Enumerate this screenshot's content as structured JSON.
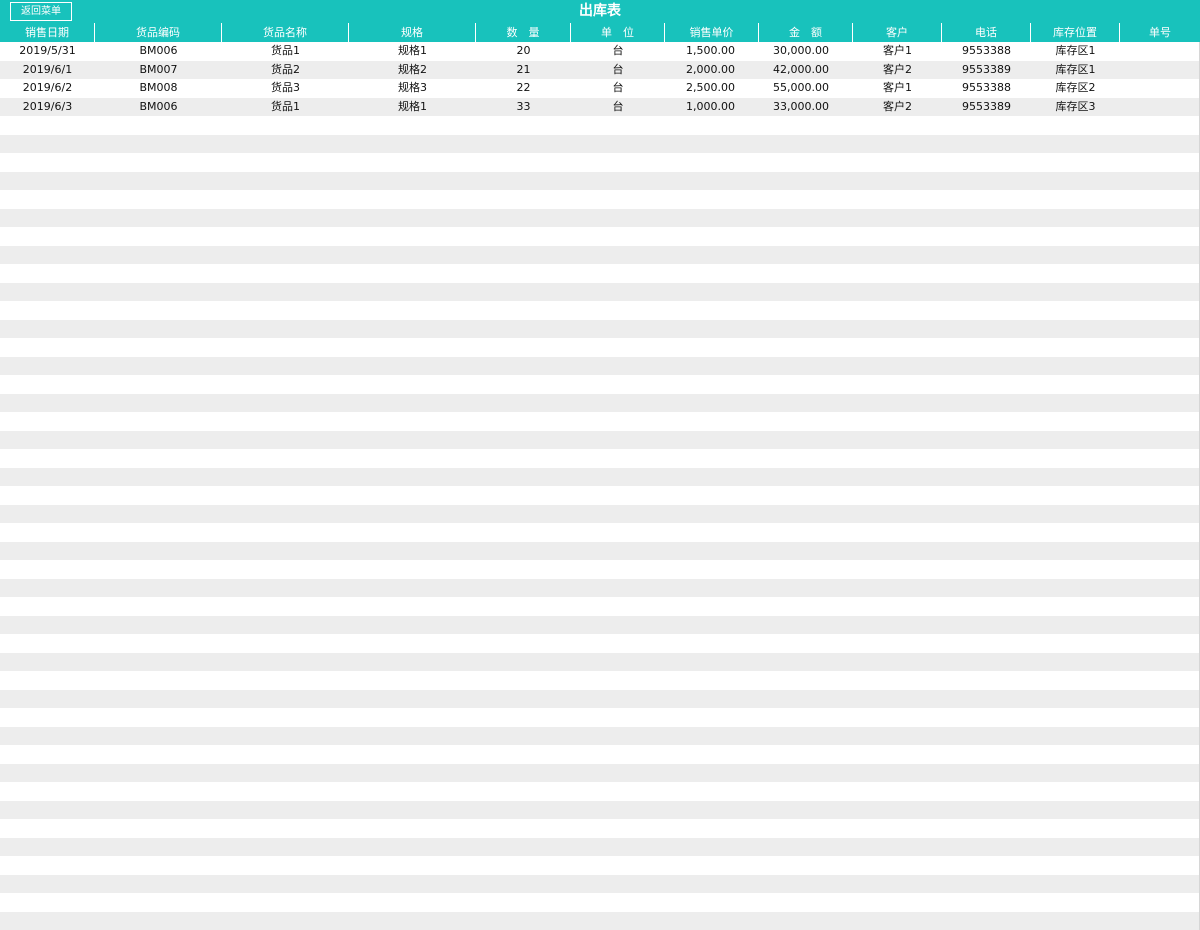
{
  "toolbar": {
    "back_label": "返回菜单"
  },
  "title": "出库表",
  "colors": {
    "header_bg": "#18c2bc",
    "header_text": "#ffffff",
    "row_alt": "#ededed",
    "row_base": "#ffffff"
  },
  "table": {
    "columns": [
      "销售日期",
      "货品编码",
      "货品名称",
      "规格",
      "数　量",
      "单　位",
      "销售单价",
      "金　额",
      "客户",
      "电话",
      "库存位置",
      "单号"
    ],
    "rows": [
      [
        "2019/5/31",
        "BM006",
        "货品1",
        "规格1",
        "20",
        "台",
        "1,500.00",
        "30,000.00",
        "客户1",
        "9553388",
        "库存区1",
        ""
      ],
      [
        "2019/6/1",
        "BM007",
        "货品2",
        "规格2",
        "21",
        "台",
        "2,000.00",
        "42,000.00",
        "客户2",
        "9553389",
        "库存区1",
        ""
      ],
      [
        "2019/6/2",
        "BM008",
        "货品3",
        "规格3",
        "22",
        "台",
        "2,500.00",
        "55,000.00",
        "客户1",
        "9553388",
        "库存区2",
        ""
      ],
      [
        "2019/6/3",
        "BM006",
        "货品1",
        "规格1",
        "33",
        "台",
        "1,000.00",
        "33,000.00",
        "客户2",
        "9553389",
        "库存区3",
        ""
      ]
    ]
  }
}
